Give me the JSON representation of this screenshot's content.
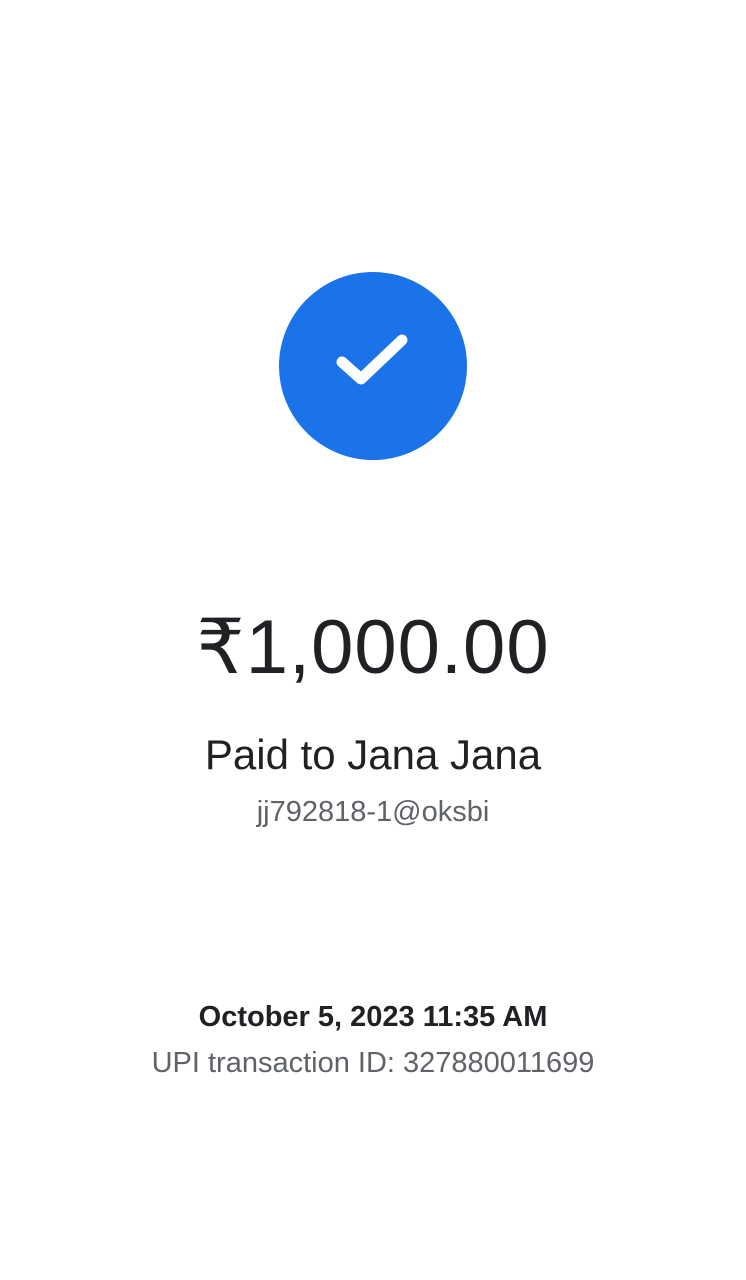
{
  "status": {
    "icon": "checkmark-icon",
    "accent_color": "#1a73e8"
  },
  "payment": {
    "amount": "₹1,000.00",
    "paid_to": "Paid to Jana Jana",
    "upi_id": "jj792818-1@oksbi"
  },
  "details": {
    "datetime": "October 5, 2023 11:35 AM",
    "transaction": "UPI transaction ID: 327880011699"
  }
}
